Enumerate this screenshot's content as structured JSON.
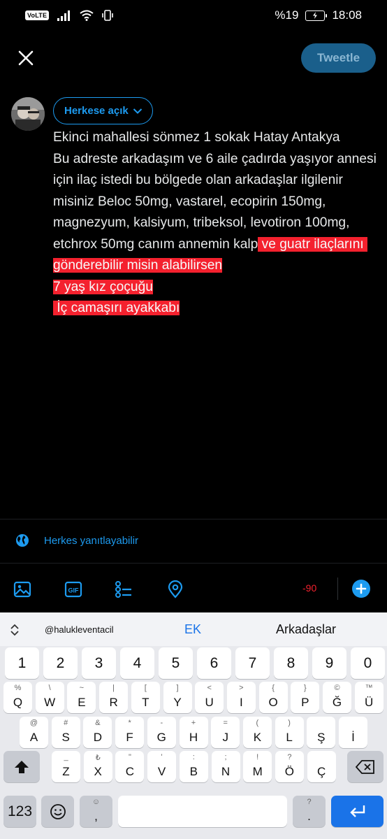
{
  "status_bar": {
    "volte": "VoLTE",
    "battery": "%19",
    "time": "18:08"
  },
  "compose": {
    "tweet_button": "Tweetle",
    "audience": "Herkese açık",
    "text_normal": "Ekinci mahallesi sönmez 1 sokak Hatay Antakya\nBu adreste arkadaşım ve 6 aile çadırda yaşıyor annesi için ilaç istedi bu bölgede olan arkadaşlar ilgilenir misiniz Beloc 50mg, vastarel, ecopirin 150mg, magnezyum, kalsiyum, tribeksol, levotiron 100mg, etchrox 50mg canım annemin kalp",
    "text_over_1": " ve guatr ilaçlarını gönderebilir misin alabilirsen",
    "text_over_2": "7 yaş kız çoçuğu",
    "text_over_3": " İç camaşırı ayakkabı",
    "reply_setting": "Herkes yanıtlayabilir",
    "char_counter": "-90"
  },
  "icons": {
    "close": "close-icon",
    "globe": "globe-icon",
    "image": "image-icon",
    "gif": "gif-icon",
    "poll": "poll-icon",
    "location": "location-icon",
    "add": "add-icon"
  },
  "keyboard": {
    "suggestions": [
      "@halukleventacil",
      "EK",
      "Arkadaşlar"
    ],
    "numbers": [
      "1",
      "2",
      "3",
      "4",
      "5",
      "6",
      "7",
      "8",
      "9",
      "0"
    ],
    "row1": [
      {
        "sup": "%",
        "key": "Q"
      },
      {
        "sup": "\\",
        "key": "W"
      },
      {
        "sup": "~",
        "key": "E"
      },
      {
        "sup": "|",
        "key": "R"
      },
      {
        "sup": "[",
        "key": "T"
      },
      {
        "sup": "]",
        "key": "Y"
      },
      {
        "sup": "<",
        "key": "U"
      },
      {
        "sup": ">",
        "key": "I"
      },
      {
        "sup": "{",
        "key": "O"
      },
      {
        "sup": "}",
        "key": "P"
      },
      {
        "sup": "©",
        "key": "Ğ"
      },
      {
        "sup": "™",
        "key": "Ü"
      }
    ],
    "row2": [
      {
        "sup": "@",
        "key": "A"
      },
      {
        "sup": "#",
        "key": "S"
      },
      {
        "sup": "&",
        "key": "D"
      },
      {
        "sup": "*",
        "key": "F"
      },
      {
        "sup": "-",
        "key": "G"
      },
      {
        "sup": "+",
        "key": "H"
      },
      {
        "sup": "=",
        "key": "J"
      },
      {
        "sup": "(",
        "key": "K"
      },
      {
        "sup": ")",
        "key": "L"
      },
      {
        "sup": "",
        "key": "Ş"
      },
      {
        "sup": "",
        "key": "İ"
      }
    ],
    "row3": [
      {
        "sup": "_",
        "key": "Z"
      },
      {
        "sup": "₺",
        "key": "X"
      },
      {
        "sup": "\"",
        "key": "C"
      },
      {
        "sup": "'",
        "key": "V"
      },
      {
        "sup": ":",
        "key": "B"
      },
      {
        "sup": ";",
        "key": "N"
      },
      {
        "sup": "!",
        "key": "M"
      },
      {
        "sup": "?",
        "key": "Ö"
      },
      {
        "sup": "",
        "key": "Ç"
      }
    ],
    "symbols_key": "123",
    "comma_sup": "☺",
    "comma": ",",
    "period_sup": "?",
    "period": ".",
    "period_sub": "!"
  }
}
